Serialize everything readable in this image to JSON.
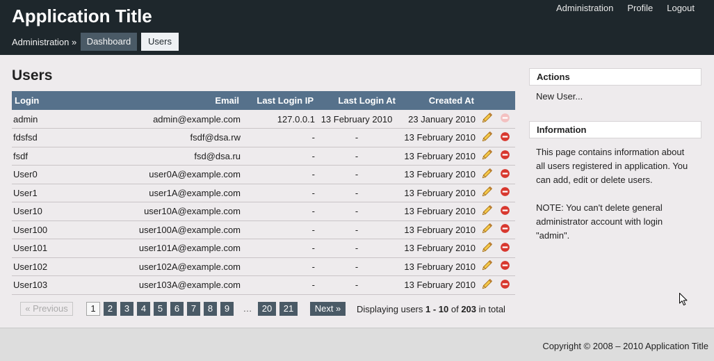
{
  "app": {
    "title": "Application Title"
  },
  "top_nav": [
    {
      "label": "Administration"
    },
    {
      "label": "Profile"
    },
    {
      "label": "Logout"
    }
  ],
  "breadcrumb": {
    "root": "Administration",
    "separator": "»"
  },
  "tabs": [
    {
      "label": "Dashboard",
      "active": false
    },
    {
      "label": "Users",
      "active": true
    }
  ],
  "page": {
    "title": "Users"
  },
  "table": {
    "columns": {
      "login": "Login",
      "email": "Email",
      "last_login_ip": "Last Login IP",
      "last_login_at": "Last Login At",
      "created_at": "Created At"
    },
    "rows": [
      {
        "login": "admin",
        "email": "admin@example.com",
        "last_login_ip": "127.0.0.1",
        "last_login_at": "13 February 2010",
        "created_at": "23 January 2010",
        "delete_enabled": false
      },
      {
        "login": "fdsfsd",
        "email": "fsdf@dsa.rw",
        "last_login_ip": "-",
        "last_login_at": "-",
        "created_at": "13 February 2010",
        "delete_enabled": true
      },
      {
        "login": "fsdf",
        "email": "fsd@dsa.ru",
        "last_login_ip": "-",
        "last_login_at": "-",
        "created_at": "13 February 2010",
        "delete_enabled": true
      },
      {
        "login": "User0",
        "email": "user0A@example.com",
        "last_login_ip": "-",
        "last_login_at": "-",
        "created_at": "13 February 2010",
        "delete_enabled": true
      },
      {
        "login": "User1",
        "email": "user1A@example.com",
        "last_login_ip": "-",
        "last_login_at": "-",
        "created_at": "13 February 2010",
        "delete_enabled": true
      },
      {
        "login": "User10",
        "email": "user10A@example.com",
        "last_login_ip": "-",
        "last_login_at": "-",
        "created_at": "13 February 2010",
        "delete_enabled": true
      },
      {
        "login": "User100",
        "email": "user100A@example.com",
        "last_login_ip": "-",
        "last_login_at": "-",
        "created_at": "13 February 2010",
        "delete_enabled": true
      },
      {
        "login": "User101",
        "email": "user101A@example.com",
        "last_login_ip": "-",
        "last_login_at": "-",
        "created_at": "13 February 2010",
        "delete_enabled": true
      },
      {
        "login": "User102",
        "email": "user102A@example.com",
        "last_login_ip": "-",
        "last_login_at": "-",
        "created_at": "13 February 2010",
        "delete_enabled": true
      },
      {
        "login": "User103",
        "email": "user103A@example.com",
        "last_login_ip": "-",
        "last_login_at": "-",
        "created_at": "13 February 2010",
        "delete_enabled": true
      }
    ]
  },
  "icons": {
    "edit": "pencil-icon",
    "delete": "delete-icon",
    "pointer": "mouse-cursor-icon"
  },
  "pagination": {
    "previous": "« Previous",
    "previous_enabled": false,
    "pages": [
      "1",
      "2",
      "3",
      "4",
      "5",
      "6",
      "7",
      "8",
      "9"
    ],
    "ellipsis": "…",
    "last_pages": [
      "20",
      "21"
    ],
    "current_page": "1",
    "next": "Next »",
    "summary": {
      "prefix": "Displaying users ",
      "range": "1 - 10",
      "of": " of ",
      "total": "203",
      "suffix": " in total"
    }
  },
  "sidebar": {
    "actions": {
      "title": "Actions",
      "items": [
        "New User..."
      ]
    },
    "information": {
      "title": "Information",
      "paragraphs": [
        "This page contains information about all users registered in application. You can add, edit or delete users.",
        "NOTE: You can't delete general administrator account with login \"admin\"."
      ]
    }
  },
  "footer": {
    "copyright": "Copyright © 2008 – 2010 Application Title"
  },
  "colors": {
    "header_bg": "#1e272c",
    "table_header_bg": "#56718b",
    "tab_bg": "#4a5a66",
    "tab_active_bg": "#eef1f4",
    "page_bg": "#eeebed",
    "footer_bg": "#dddddd",
    "delete_icon": "#d8382f",
    "delete_icon_disabled": "#f3c0c0"
  }
}
